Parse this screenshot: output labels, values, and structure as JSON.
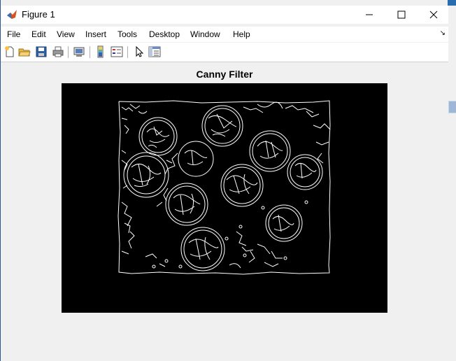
{
  "window": {
    "title": "Figure 1"
  },
  "menu": {
    "items": [
      "File",
      "Edit",
      "View",
      "Insert",
      "Tools",
      "Desktop",
      "Window",
      "Help"
    ]
  },
  "toolbar": {
    "buttons": [
      "new-figure-icon",
      "open-file-icon",
      "save-icon",
      "print-icon",
      "print-preview-icon",
      "colorbar-icon",
      "legend-icon",
      "select-pointer-icon",
      "property-inspector-icon"
    ]
  },
  "figure": {
    "title": "Canny Filter"
  },
  "colors": {
    "background": "#f0f0f0",
    "axes": "#000000",
    "edges": "#ffffff"
  }
}
